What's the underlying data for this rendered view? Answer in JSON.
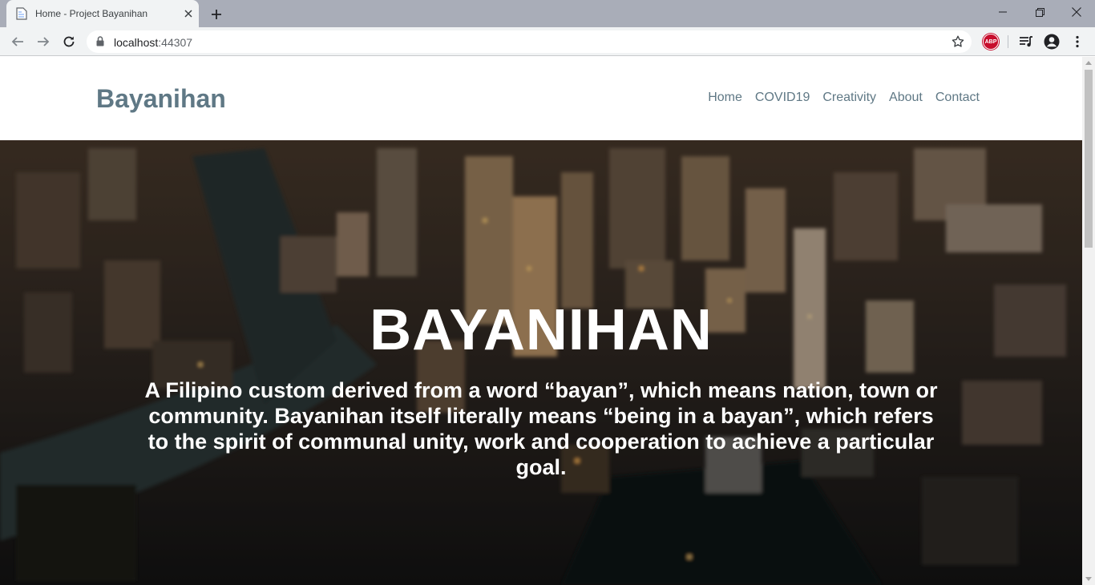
{
  "browser": {
    "tab": {
      "title": "Home - Project Bayanihan"
    },
    "address": {
      "host": "localhost",
      "port": ":44307"
    },
    "extension_label": "ABP"
  },
  "site": {
    "brand": "Bayanihan",
    "nav": [
      "Home",
      "COVID19",
      "Creativity",
      "About",
      "Contact"
    ]
  },
  "hero": {
    "title": "BAYANIHAN",
    "text": "A Filipino custom derived from a word “bayan”, which means nation, town or community. Bayanihan itself literally means “being in a bayan”, which refers to the spirit of communal unity, work and cooperation to achieve a particular goal."
  },
  "colors": {
    "brand": "#5f7885",
    "tabstrip": "#a9adb8",
    "toolbar": "#f1f3f4",
    "abp": "#c70d2c"
  },
  "icons": [
    "page-icon",
    "close-icon",
    "plus-icon",
    "minimize-icon",
    "restore-icon",
    "back-icon",
    "forward-icon",
    "reload-icon",
    "lock-icon",
    "star-icon",
    "media-icon",
    "account-icon",
    "menu-icon"
  ]
}
